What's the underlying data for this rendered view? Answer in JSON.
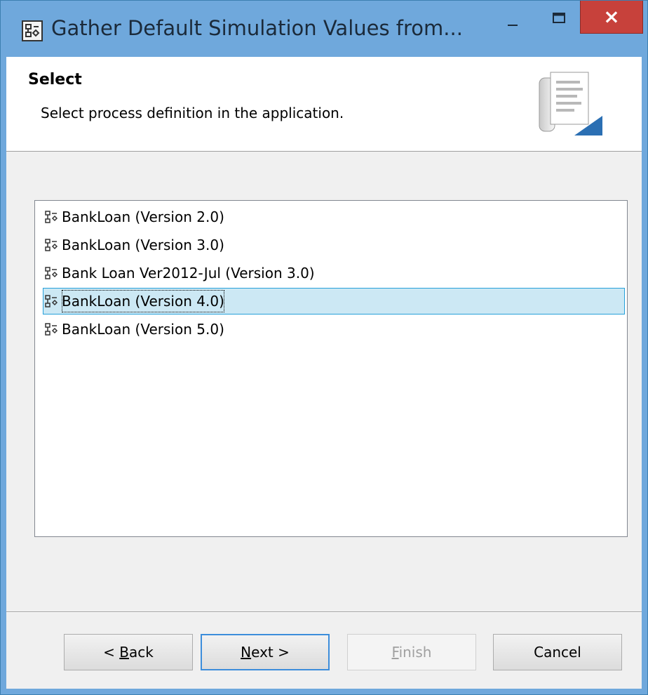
{
  "window": {
    "title": "Gather Default Simulation Values from...",
    "controls": {
      "minimize": "–",
      "maximize": "□",
      "close": "×"
    }
  },
  "banner": {
    "title": "Select",
    "description": "Select process definition in the application."
  },
  "process_list": {
    "items": [
      {
        "label": "BankLoan (Version 2.0)",
        "selected": false
      },
      {
        "label": "BankLoan (Version 3.0)",
        "selected": false
      },
      {
        "label": "Bank Loan Ver2012-Jul (Version 3.0)",
        "selected": false
      },
      {
        "label": "BankLoan (Version 4.0)",
        "selected": true
      },
      {
        "label": "BankLoan (Version 5.0)",
        "selected": false
      }
    ]
  },
  "buttons": {
    "back": {
      "prefix": "< ",
      "mnemonic": "B",
      "rest": "ack"
    },
    "next": {
      "mnemonic": "N",
      "rest": "ext >"
    },
    "finish": {
      "mnemonic": "F",
      "rest": "inish"
    },
    "cancel": "Cancel"
  },
  "colors": {
    "titlebar": "#6fa8dc",
    "close_button": "#c7413b",
    "selection_bg": "#cce8f4",
    "selection_border": "#26a0da"
  }
}
